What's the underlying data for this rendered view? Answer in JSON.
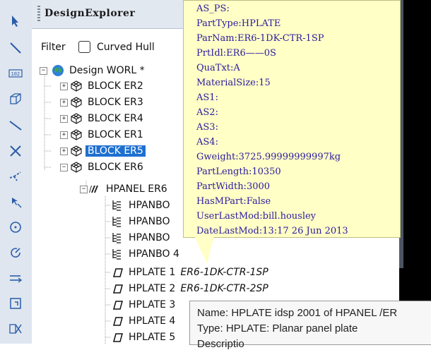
{
  "panel": {
    "title": "DesignExplorer",
    "filter_label": "Filter",
    "filter_value": "Curved Hull"
  },
  "tree": {
    "root": "Design WORL *",
    "blocks": [
      "BLOCK ER2",
      "BLOCK ER3",
      "BLOCK ER4",
      "BLOCK ER1",
      "BLOCK ER5",
      "BLOCK ER6"
    ],
    "selected_block": "BLOCK ER5",
    "panel_node": "HPANEL ER6",
    "hpanbo": [
      "HPANBO",
      "HPANBO",
      "HPANBO",
      "HPANBO 4"
    ],
    "hplates": [
      {
        "name": "HPLATE 1",
        "desc": "ER6-1DK-CTR-1SP"
      },
      {
        "name": "HPLATE 2",
        "desc": "ER6-1DK-CTR-2SP"
      },
      {
        "name": "HPLATE 3",
        "desc": ""
      },
      {
        "name": "HPLATE 4",
        "desc": ""
      },
      {
        "name": "HPLATE 5",
        "desc": ""
      }
    ]
  },
  "tooltip": {
    "lines": [
      "AS_PS:",
      "PartType:HPLATE",
      "ParNam:ER6-1DK-CTR-1SP",
      "PrtIdl:ER6——0S",
      "QuaTxt:A",
      "MaterialSize:15",
      "AS1:",
      "AS2:",
      "AS3:",
      "AS4:",
      "Gweight:3725.99999999997kg",
      "PartLength:10350",
      "PartWidth:3000",
      "HasMPart:False",
      "UserLastMod:bill.housley",
      "DateLastMod:13:17  26 Jun 2013"
    ]
  },
  "hover_tip": {
    "name_line": "Name: HPLATE idsp 2001 of HPANEL /ER",
    "type_line": "Type: HPLATE: Planar panel plate",
    "desc_line": "Descriptio"
  },
  "icons": [
    "select-arrow-icon",
    "line-tool-icon",
    "numeric-icon",
    "box-3d-icon",
    "diagonal-line-icon",
    "cross-icon",
    "branch-icon",
    "pointer-select-icon",
    "circle-icon",
    "rotate-icon",
    "parallel-arrows-icon",
    "frame-icon",
    "grid-cross-icon"
  ],
  "colors": {
    "selection": "#1e6fd0",
    "tooltip_bg": "#ffffc6",
    "tooltip_text": "#2b1aa0"
  }
}
